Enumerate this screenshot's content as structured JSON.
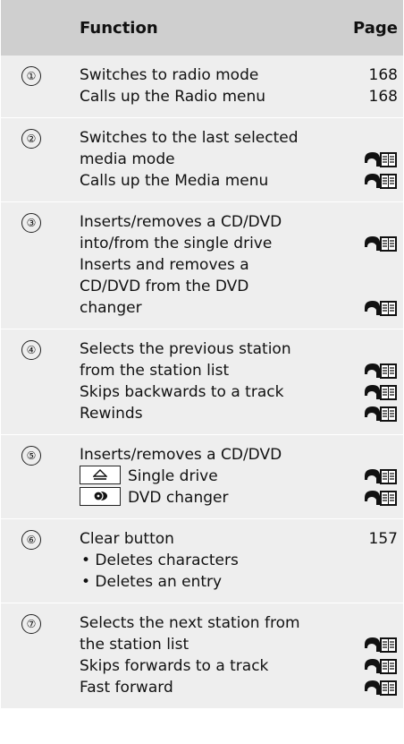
{
  "header": {
    "num": "",
    "function": "Function",
    "page": "Page"
  },
  "icons": {
    "page_ref": "book-reference-icon",
    "eject": "eject-icon",
    "dvd_changer": "dvd-changer-icon"
  },
  "rows": [
    {
      "num": "①",
      "lines": [
        "Switches to radio mode",
        "Calls up the Radio menu"
      ],
      "pages": [
        "168",
        "168"
      ]
    },
    {
      "num": "②",
      "lines": [
        "Switches to the last selected",
        "media mode",
        "Calls up the Media menu"
      ]
    },
    {
      "num": "③",
      "lines": [
        "Inserts/removes a CD/DVD",
        "into/from the single drive",
        "Inserts and removes a",
        "CD/DVD from the DVD",
        "changer"
      ]
    },
    {
      "num": "④",
      "lines": [
        "Selects the previous station",
        "from the station list",
        "Skips backwards to a track",
        "Rewinds"
      ]
    },
    {
      "num": "⑤",
      "lines": [
        "Inserts/removes a CD/DVD",
        "Single drive",
        "DVD changer"
      ]
    },
    {
      "num": "⑥",
      "lines": [
        "Clear button",
        "• Deletes characters",
        "• Deletes an entry"
      ],
      "pages": [
        "157"
      ]
    },
    {
      "num": "⑦",
      "lines": [
        "Selects the next station from",
        "the station list",
        "Skips forwards to a track",
        "Fast forward"
      ]
    }
  ]
}
